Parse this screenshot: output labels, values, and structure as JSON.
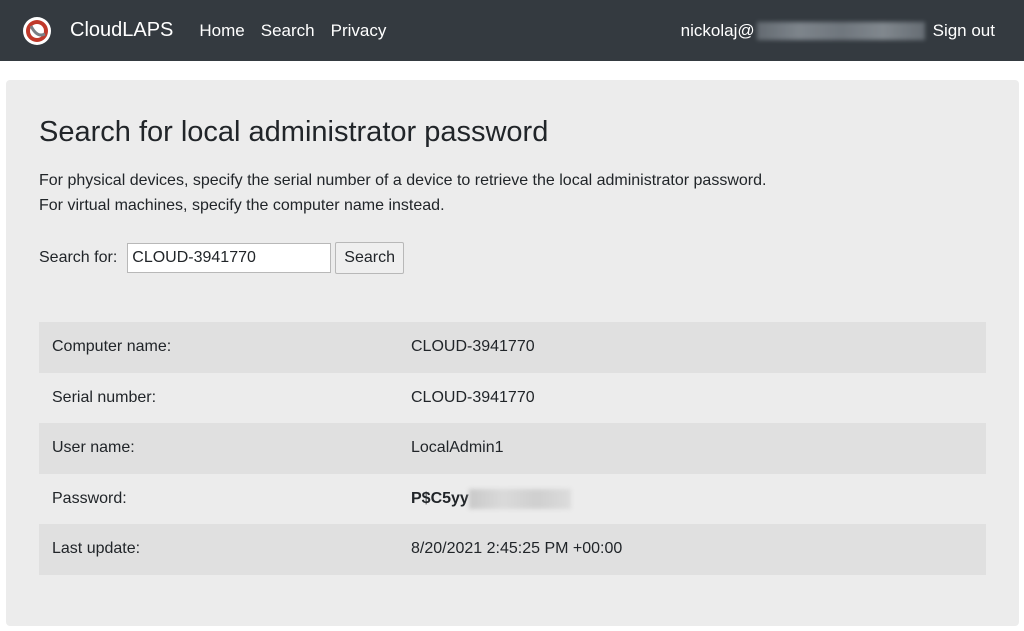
{
  "navbar": {
    "brand": "CloudLAPS",
    "links": [
      "Home",
      "Search",
      "Privacy"
    ],
    "user_prefix": "nickolaj@",
    "sign_out": "Sign out",
    "logo_icon": "cloudlaps-logo-icon"
  },
  "page": {
    "title": "Search for local administrator password",
    "description_line1": "For physical devices, specify the serial number of a device to retrieve the local administrator password.",
    "description_line2": "For virtual machines, specify the computer name instead."
  },
  "search": {
    "label": "Search for:",
    "value": "CLOUD-3941770",
    "button": "Search"
  },
  "results": [
    {
      "label": "Computer name:",
      "value": "CLOUD-3941770"
    },
    {
      "label": "Serial number:",
      "value": "CLOUD-3941770"
    },
    {
      "label": "User name:",
      "value": "LocalAdmin1"
    },
    {
      "label": "Password:",
      "value": "P$C5yy"
    },
    {
      "label": "Last update:",
      "value": "8/20/2021 2:45:25 PM +00:00"
    }
  ],
  "colors": {
    "navbar_bg": "#343a40",
    "panel_bg": "#ececec",
    "row_alt_bg": "#e0e0e0",
    "logo_accent": "#c0392b"
  }
}
